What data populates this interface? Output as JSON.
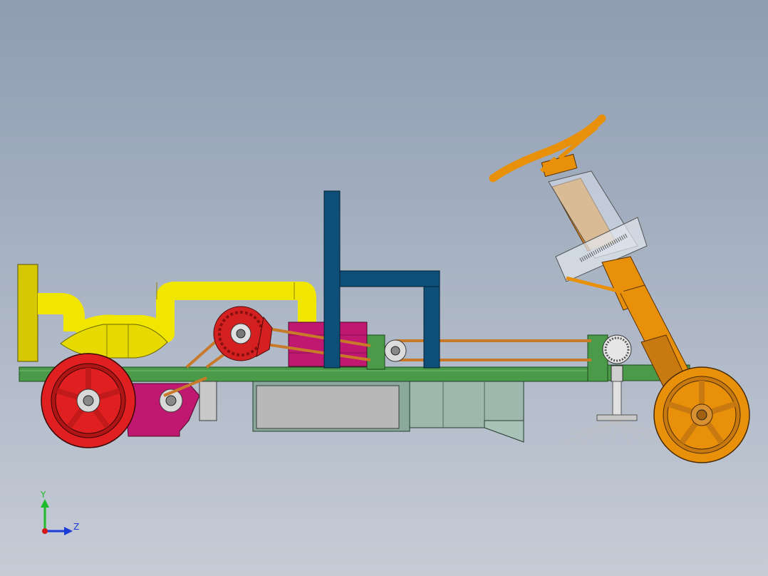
{
  "viewport": {
    "background_top": "#8e9db2",
    "background_bottom": "#c6ccd6"
  },
  "model": {
    "frame_color": "#4a9a4a",
    "exhaust_color": "#e8e000",
    "seat_color": "#0e4f7a",
    "steering_color": "#e8900a",
    "rear_wheel_color": "#e02020",
    "gearbox_color": "#c01870",
    "tank_color": "#9fb8ad",
    "belt_color": "#c87a2a",
    "brush_color": "#e9e9e9"
  },
  "triad": {
    "y_label": "Y",
    "z_label": "Z",
    "y_color": "#1dbb2a",
    "z_color": "#1b3bd6",
    "x_color": "#d41818"
  }
}
